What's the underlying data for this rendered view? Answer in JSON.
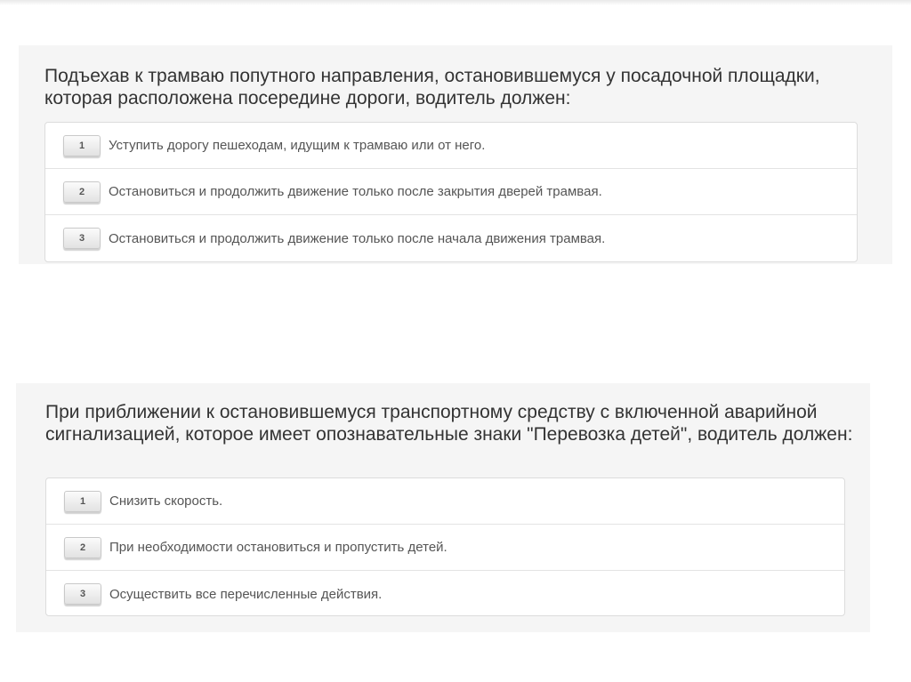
{
  "questions": [
    {
      "text": "Подъехав к трамваю попутного направления, остановившемуся у посадочной площадки, которая расположена посередине дороги, водитель должен:",
      "answers": [
        {
          "num": "1",
          "text": "Уступить дорогу пешеходам, идущим к трамваю или от него."
        },
        {
          "num": "2",
          "text": "Остановиться и продолжить движение только после закрытия дверей трамвая."
        },
        {
          "num": "3",
          "text": "Остановиться и продолжить движение только после начала движения трамвая."
        }
      ]
    },
    {
      "text": "При приближении к остановившемуся транспортному средству с включенной аварийной сигнализацией, которое имеет опознавательные знаки \"Перевозка детей\", водитель должен:",
      "answers": [
        {
          "num": "1",
          "text": "Снизить скорость."
        },
        {
          "num": "2",
          "text": "При необходимости остановиться и пропустить детей."
        },
        {
          "num": "3",
          "text": "Осуществить все перечисленные действия."
        }
      ]
    }
  ]
}
